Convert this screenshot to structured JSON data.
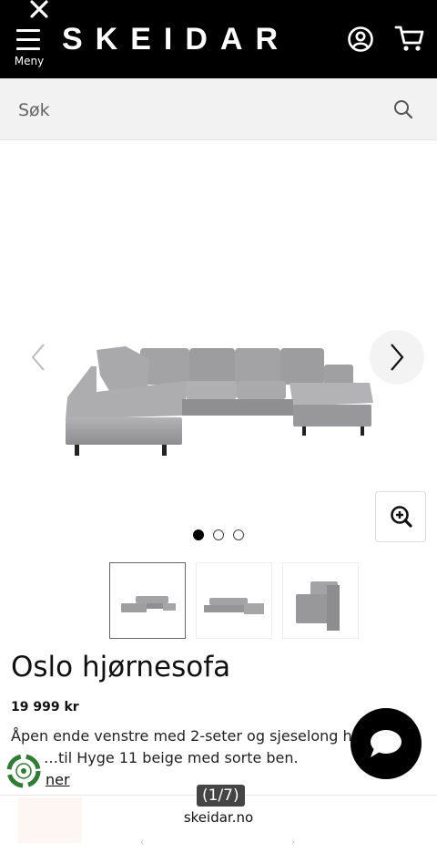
{
  "header": {
    "brand": "SKEIDAR",
    "menu_label": "Meny",
    "close_icon": "close-icon",
    "menu_icon": "hamburger-icon",
    "account_icon": "user-circle-icon",
    "cart_icon": "shopping-cart-icon"
  },
  "search": {
    "placeholder": "Søk",
    "icon": "search-icon"
  },
  "gallery": {
    "current_slide": 1,
    "slide_count": 3,
    "prev_icon": "chevron-left-icon",
    "next_icon": "chevron-right-icon",
    "zoom_icon": "zoom-in-icon",
    "sofa_color": "#9a9a9c",
    "thumbnails": 3
  },
  "product": {
    "title": "Oslo hjørnesofa",
    "price": "19 999 kr",
    "description_line1": "Åpen ende venstre med 2-seter og sjeselong h",
    "description_line2": "…til Hyge 11 beige med sorte ben.",
    "more_link": "ner"
  },
  "browser": {
    "page_counter": "(1/7)",
    "domain": "skeidar.no"
  },
  "colors": {
    "header_bg": "#000000",
    "search_bg": "#f2f2f2",
    "eco_green": "#2e7d32"
  }
}
